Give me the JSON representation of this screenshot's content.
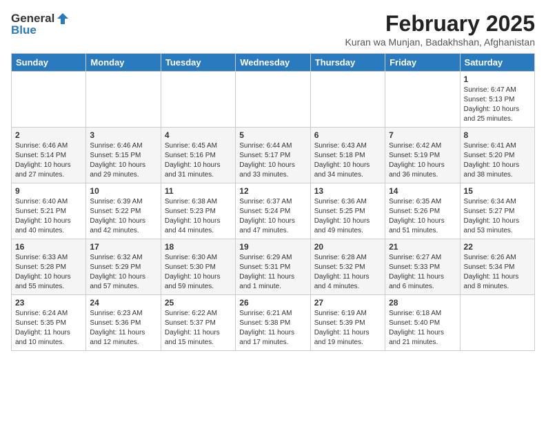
{
  "header": {
    "logo_general": "General",
    "logo_blue": "Blue",
    "month_title": "February 2025",
    "location": "Kuran wa Munjan, Badakhshan, Afghanistan"
  },
  "weekdays": [
    "Sunday",
    "Monday",
    "Tuesday",
    "Wednesday",
    "Thursday",
    "Friday",
    "Saturday"
  ],
  "weeks": [
    [
      {
        "day": "",
        "info": ""
      },
      {
        "day": "",
        "info": ""
      },
      {
        "day": "",
        "info": ""
      },
      {
        "day": "",
        "info": ""
      },
      {
        "day": "",
        "info": ""
      },
      {
        "day": "",
        "info": ""
      },
      {
        "day": "1",
        "info": "Sunrise: 6:47 AM\nSunset: 5:13 PM\nDaylight: 10 hours and 25 minutes."
      }
    ],
    [
      {
        "day": "2",
        "info": "Sunrise: 6:46 AM\nSunset: 5:14 PM\nDaylight: 10 hours and 27 minutes."
      },
      {
        "day": "3",
        "info": "Sunrise: 6:46 AM\nSunset: 5:15 PM\nDaylight: 10 hours and 29 minutes."
      },
      {
        "day": "4",
        "info": "Sunrise: 6:45 AM\nSunset: 5:16 PM\nDaylight: 10 hours and 31 minutes."
      },
      {
        "day": "5",
        "info": "Sunrise: 6:44 AM\nSunset: 5:17 PM\nDaylight: 10 hours and 33 minutes."
      },
      {
        "day": "6",
        "info": "Sunrise: 6:43 AM\nSunset: 5:18 PM\nDaylight: 10 hours and 34 minutes."
      },
      {
        "day": "7",
        "info": "Sunrise: 6:42 AM\nSunset: 5:19 PM\nDaylight: 10 hours and 36 minutes."
      },
      {
        "day": "8",
        "info": "Sunrise: 6:41 AM\nSunset: 5:20 PM\nDaylight: 10 hours and 38 minutes."
      }
    ],
    [
      {
        "day": "9",
        "info": "Sunrise: 6:40 AM\nSunset: 5:21 PM\nDaylight: 10 hours and 40 minutes."
      },
      {
        "day": "10",
        "info": "Sunrise: 6:39 AM\nSunset: 5:22 PM\nDaylight: 10 hours and 42 minutes."
      },
      {
        "day": "11",
        "info": "Sunrise: 6:38 AM\nSunset: 5:23 PM\nDaylight: 10 hours and 44 minutes."
      },
      {
        "day": "12",
        "info": "Sunrise: 6:37 AM\nSunset: 5:24 PM\nDaylight: 10 hours and 47 minutes."
      },
      {
        "day": "13",
        "info": "Sunrise: 6:36 AM\nSunset: 5:25 PM\nDaylight: 10 hours and 49 minutes."
      },
      {
        "day": "14",
        "info": "Sunrise: 6:35 AM\nSunset: 5:26 PM\nDaylight: 10 hours and 51 minutes."
      },
      {
        "day": "15",
        "info": "Sunrise: 6:34 AM\nSunset: 5:27 PM\nDaylight: 10 hours and 53 minutes."
      }
    ],
    [
      {
        "day": "16",
        "info": "Sunrise: 6:33 AM\nSunset: 5:28 PM\nDaylight: 10 hours and 55 minutes."
      },
      {
        "day": "17",
        "info": "Sunrise: 6:32 AM\nSunset: 5:29 PM\nDaylight: 10 hours and 57 minutes."
      },
      {
        "day": "18",
        "info": "Sunrise: 6:30 AM\nSunset: 5:30 PM\nDaylight: 10 hours and 59 minutes."
      },
      {
        "day": "19",
        "info": "Sunrise: 6:29 AM\nSunset: 5:31 PM\nDaylight: 11 hours and 1 minute."
      },
      {
        "day": "20",
        "info": "Sunrise: 6:28 AM\nSunset: 5:32 PM\nDaylight: 11 hours and 4 minutes."
      },
      {
        "day": "21",
        "info": "Sunrise: 6:27 AM\nSunset: 5:33 PM\nDaylight: 11 hours and 6 minutes."
      },
      {
        "day": "22",
        "info": "Sunrise: 6:26 AM\nSunset: 5:34 PM\nDaylight: 11 hours and 8 minutes."
      }
    ],
    [
      {
        "day": "23",
        "info": "Sunrise: 6:24 AM\nSunset: 5:35 PM\nDaylight: 11 hours and 10 minutes."
      },
      {
        "day": "24",
        "info": "Sunrise: 6:23 AM\nSunset: 5:36 PM\nDaylight: 11 hours and 12 minutes."
      },
      {
        "day": "25",
        "info": "Sunrise: 6:22 AM\nSunset: 5:37 PM\nDaylight: 11 hours and 15 minutes."
      },
      {
        "day": "26",
        "info": "Sunrise: 6:21 AM\nSunset: 5:38 PM\nDaylight: 11 hours and 17 minutes."
      },
      {
        "day": "27",
        "info": "Sunrise: 6:19 AM\nSunset: 5:39 PM\nDaylight: 11 hours and 19 minutes."
      },
      {
        "day": "28",
        "info": "Sunrise: 6:18 AM\nSunset: 5:40 PM\nDaylight: 11 hours and 21 minutes."
      },
      {
        "day": "",
        "info": ""
      }
    ]
  ]
}
